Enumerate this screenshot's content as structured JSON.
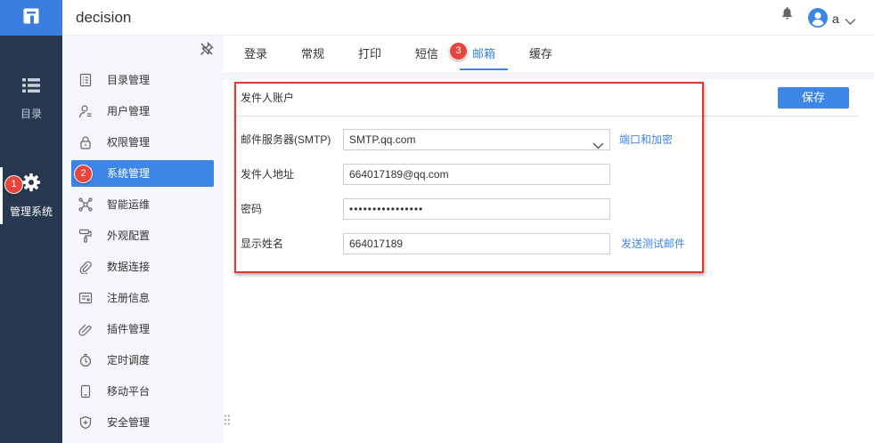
{
  "app": {
    "title": "decision",
    "logo_icon": "app-logo-icon"
  },
  "header": {
    "notification_icon": "bell-icon",
    "avatar_icon": "avatar-icon",
    "user_name": "a",
    "menu_icon": "chevron-down-icon"
  },
  "rail": {
    "items": [
      {
        "label": "目录",
        "icon": "list-icon",
        "active": false
      },
      {
        "label": "管理系统",
        "icon": "gear-icon",
        "active": true
      }
    ]
  },
  "sidebar": {
    "pin_icon": "pin-icon",
    "items": [
      {
        "label": "目录管理",
        "icon": "catalog-icon",
        "active": false
      },
      {
        "label": "用户管理",
        "icon": "user-icon",
        "active": false
      },
      {
        "label": "权限管理",
        "icon": "lock-icon",
        "active": false
      },
      {
        "label": "系统管理",
        "icon": "system-icon",
        "active": true
      },
      {
        "label": "智能运维",
        "icon": "network-icon",
        "active": false
      },
      {
        "label": "外观配置",
        "icon": "paint-roller-icon",
        "active": false
      },
      {
        "label": "数据连接",
        "icon": "link-icon",
        "active": false
      },
      {
        "label": "注册信息",
        "icon": "register-icon",
        "active": false
      },
      {
        "label": "插件管理",
        "icon": "plugin-icon",
        "active": false
      },
      {
        "label": "定时调度",
        "icon": "timer-icon",
        "active": false
      },
      {
        "label": "移动平台",
        "icon": "mobile-icon",
        "active": false
      },
      {
        "label": "安全管理",
        "icon": "shield-icon",
        "active": false
      }
    ]
  },
  "tabs": {
    "items": [
      {
        "label": "登录",
        "active": false
      },
      {
        "label": "常规",
        "active": false
      },
      {
        "label": "打印",
        "active": false
      },
      {
        "label": "短信",
        "active": false
      },
      {
        "label": "邮箱",
        "active": true
      },
      {
        "label": "缓存",
        "active": false
      }
    ]
  },
  "email": {
    "section_title": "发件人账户",
    "save_label": "保存",
    "smtp": {
      "label": "邮件服务器(SMTP)",
      "value": "SMTP.qq.com",
      "link": "端口和加密"
    },
    "sender": {
      "label": "发件人地址",
      "value": "664017189@qq.com"
    },
    "password": {
      "label": "密码",
      "value": "••••••••••••••••"
    },
    "display_name": {
      "label": "显示姓名",
      "value": "664017189",
      "link": "发送测试邮件"
    }
  },
  "annotations": {
    "badges": [
      "1",
      "2",
      "3"
    ]
  },
  "colors": {
    "brand": "#3a7fe0",
    "rail_bg": "#283850",
    "sidebar_bg": "#f4f6f9",
    "accent": "#3d86e8",
    "annotation_red": "#d93a32",
    "badge_red": "#e8453c",
    "text": "#333333"
  }
}
